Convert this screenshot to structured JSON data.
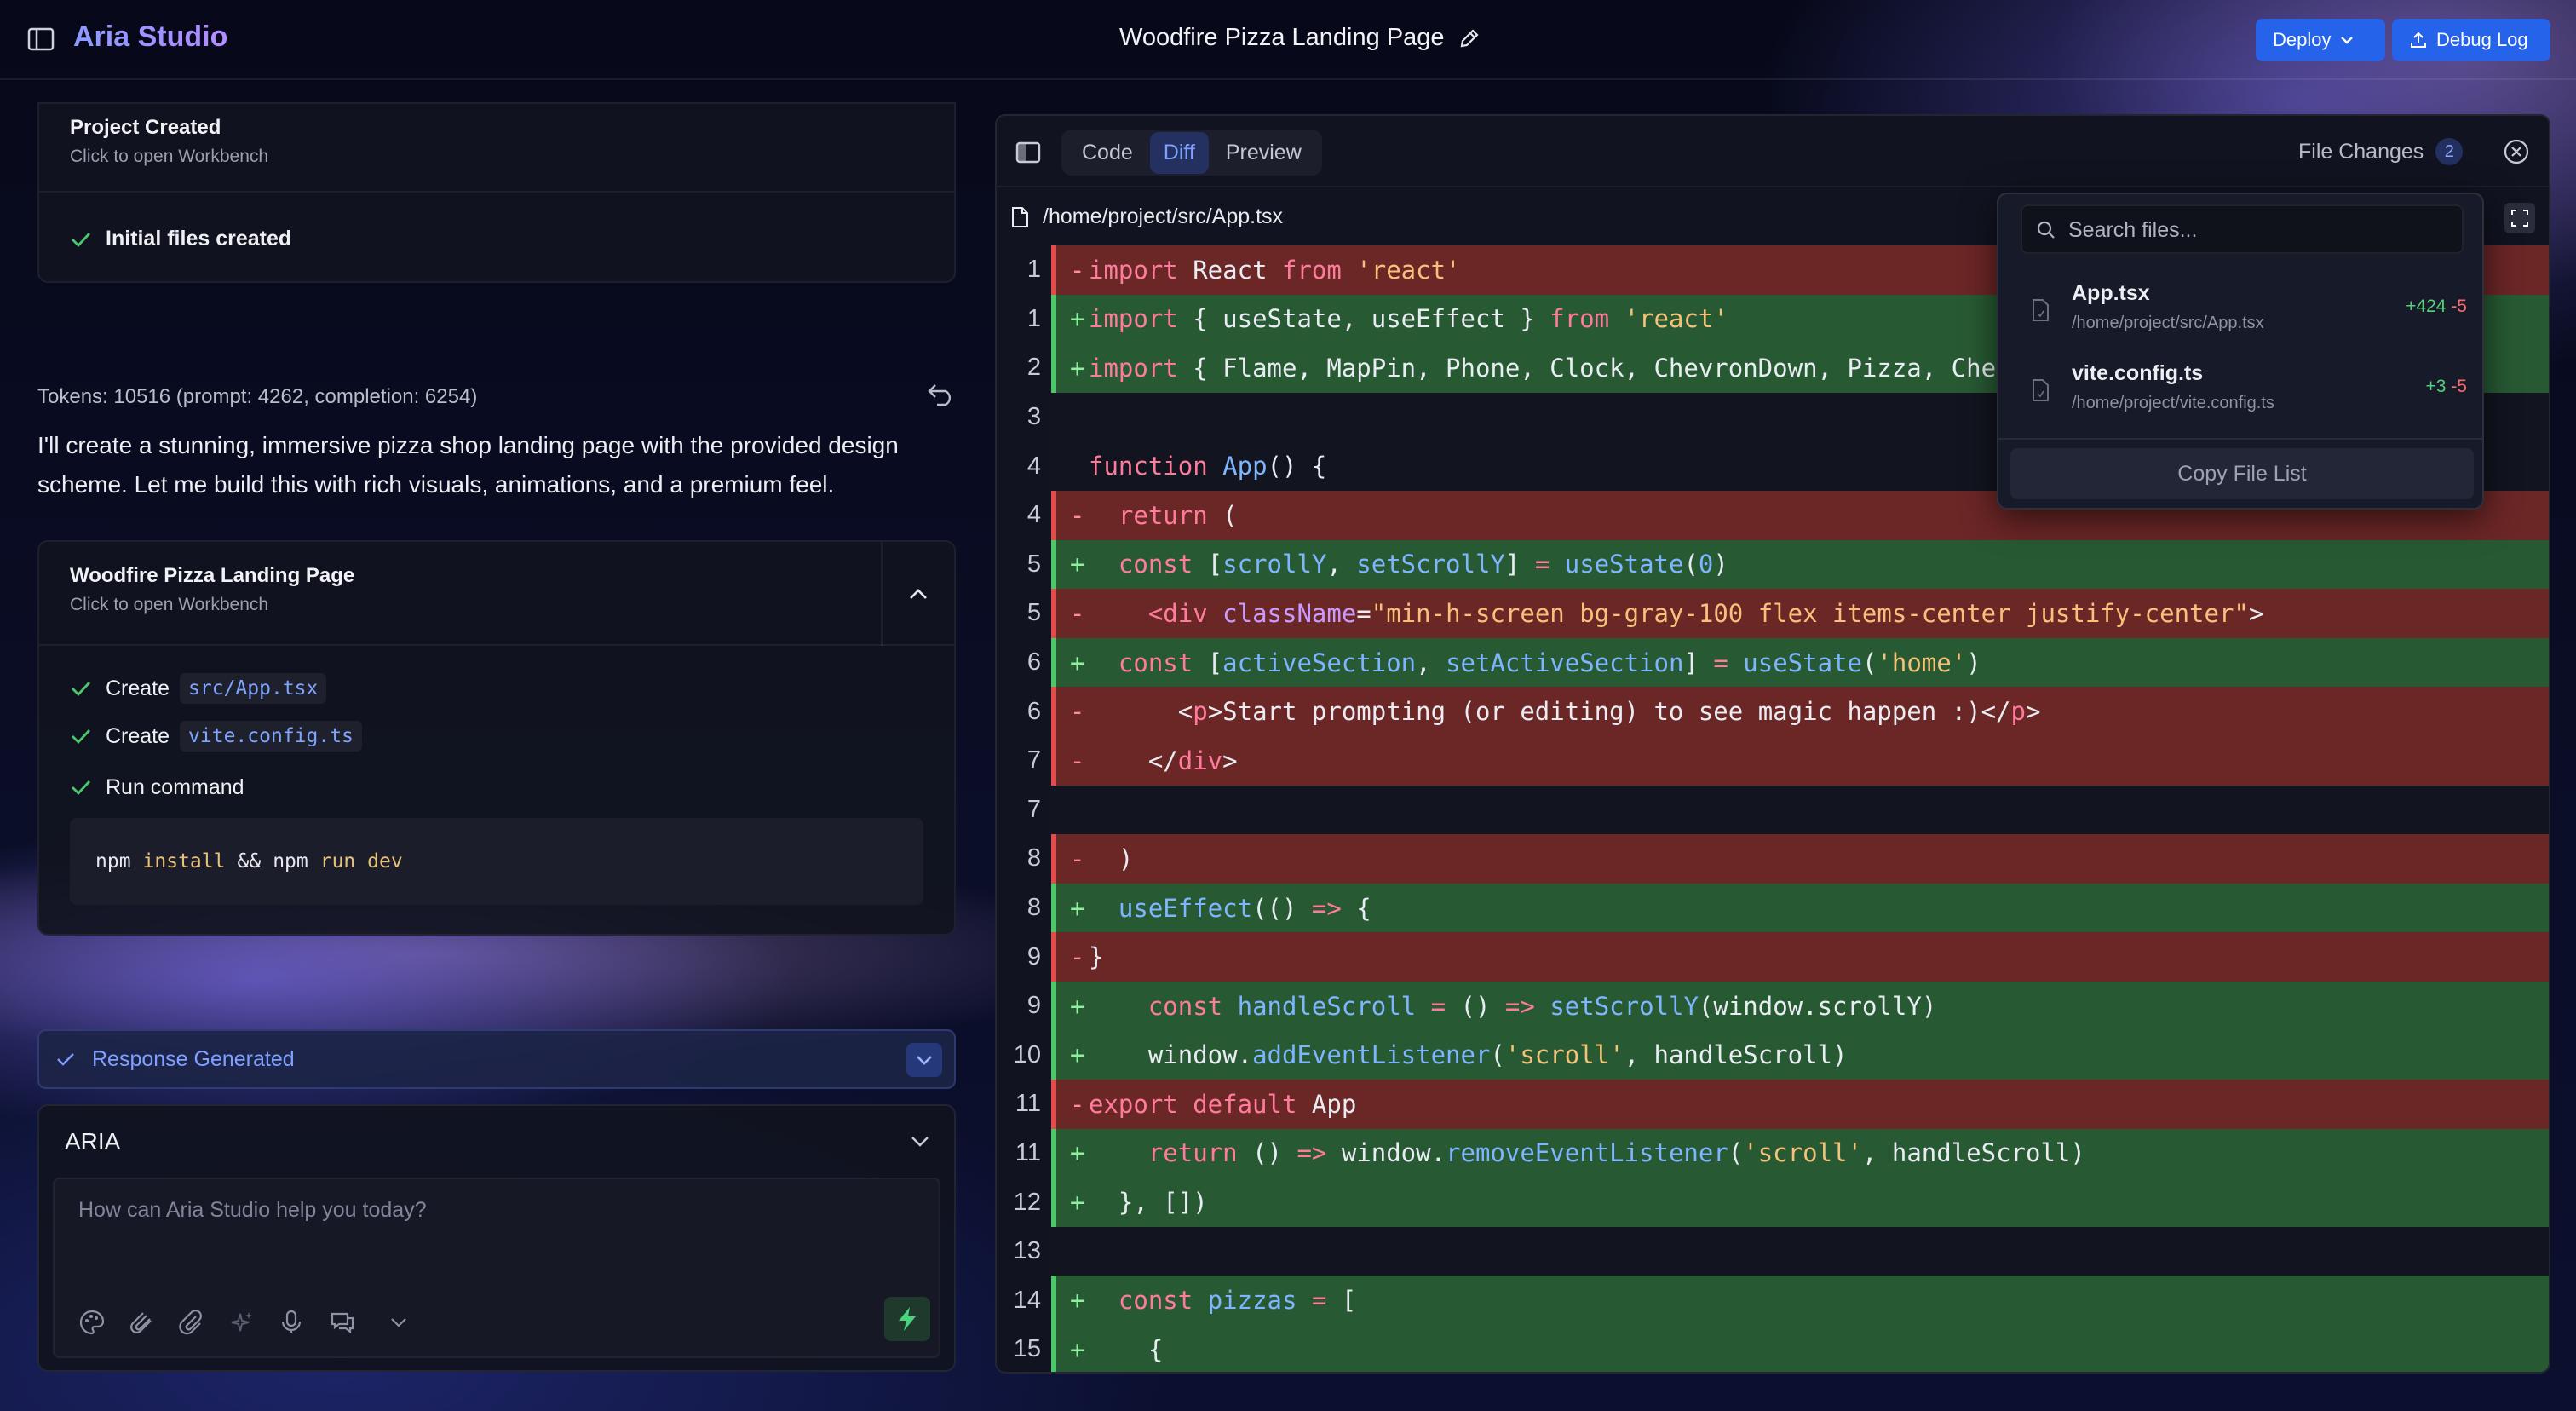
{
  "app": {
    "brand": "Aria Studio",
    "project_title": "Woodfire Pizza Landing Page",
    "deploy_label": "Deploy",
    "debug_label": "Debug Log"
  },
  "chat": {
    "card1": {
      "title": "Project Created",
      "subtitle": "Click to open Workbench",
      "item": "Initial files created"
    },
    "tokens": "Tokens: 10516 (prompt: 4262, completion: 6254)",
    "message": "I'll create a stunning, immersive pizza shop landing page with the provided design scheme. Let me build this with rich visuals, animations, and a premium feel.",
    "card2": {
      "title": "Woodfire Pizza Landing Page",
      "subtitle": "Click to open Workbench",
      "items": [
        {
          "action": "Create",
          "file": "src/App.tsx"
        },
        {
          "action": "Create",
          "file": "vite.config.ts"
        }
      ],
      "run_label": "Run command",
      "command": {
        "a": "npm",
        "b": "install",
        "c": "&&",
        "d": "npm",
        "e": "run dev"
      }
    },
    "response_label": "Response Generated",
    "model": "ARIA",
    "input_placeholder": "How can Aria Studio help you today?"
  },
  "workbench": {
    "tabs": [
      "Code",
      "Diff",
      "Preview"
    ],
    "active_tab": "Diff",
    "file_changes_label": "File Changes",
    "file_changes_count": "2",
    "file_path": "/home/project/src/App.tsx"
  },
  "file_popup": {
    "search_placeholder": "Search files...",
    "files": [
      {
        "name": "App.tsx",
        "path": "/home/project/src/App.tsx",
        "added": "+424",
        "removed": "-5"
      },
      {
        "name": "vite.config.ts",
        "path": "/home/project/vite.config.ts",
        "added": "+3",
        "removed": "-5"
      }
    ],
    "copy_label": "Copy File List"
  },
  "diff_lines": [
    {
      "n": "1",
      "t": "del",
      "m": "-",
      "html": "<span class='kw'>import</span> React <span class='kw'>from</span> <span class='str'>'react'</span>"
    },
    {
      "n": "1",
      "t": "add",
      "m": "+",
      "html": "<span class='kw'>import</span> { useState, useEffect } <span class='kw'>from</span> <span class='str'>'react'</span>"
    },
    {
      "n": "2",
      "t": "add",
      "m": "+",
      "html": "<span class='kw'>import</span> { Flame, MapPin, Phone, Clock, ChevronDown, Pizza, ChefHat, Star, Instagra"
    },
    {
      "n": "3",
      "t": "ctx",
      "m": "",
      "html": ""
    },
    {
      "n": "4",
      "t": "ctx",
      "m": "",
      "html": "<span class='kw'>function</span> <span class='fn'>App</span>() {"
    },
    {
      "n": "4",
      "t": "del",
      "m": "-",
      "html": "  <span class='kw'>return</span> ("
    },
    {
      "n": "5",
      "t": "add",
      "m": "+",
      "html": "  <span class='kw'>const</span> [<span class='fn'>scrollY</span>, <span class='fn'>setScrollY</span>] <span class='kw'>=</span> <span class='fn'>useState</span>(<span class='fn'>0</span>)"
    },
    {
      "n": "5",
      "t": "del",
      "m": "-",
      "html": "    <span class='tag'>&lt;div</span> <span class='attr'>className</span>=<span class='str'>\"min-h-screen bg-gray-100 flex items-center justify-center\"</span>&gt;"
    },
    {
      "n": "6",
      "t": "add",
      "m": "+",
      "html": "  <span class='kw'>const</span> [<span class='fn'>activeSection</span>, <span class='fn'>setActiveSection</span>] <span class='kw'>=</span> <span class='fn'>useState</span>(<span class='str'>'home'</span>)"
    },
    {
      "n": "6",
      "t": "del",
      "m": "-",
      "html": "      &lt;<span class='tag'>p</span>&gt;Start prompting (or editing) to see magic happen :)&lt;/<span class='tag'>p</span>&gt;"
    },
    {
      "n": "7",
      "t": "del",
      "m": "-",
      "html": "    &lt;/<span class='tag'>div</span>&gt;"
    },
    {
      "n": "7",
      "t": "ctx",
      "m": "",
      "html": ""
    },
    {
      "n": "8",
      "t": "del",
      "m": "-",
      "html": "  )"
    },
    {
      "n": "8",
      "t": "add",
      "m": "+",
      "html": "  <span class='fn'>useEffect</span>(() <span class='kw'>=&gt;</span> {"
    },
    {
      "n": "9",
      "t": "del",
      "m": "-",
      "html": "}"
    },
    {
      "n": "9",
      "t": "add",
      "m": "+",
      "html": "    <span class='kw'>const</span> <span class='fn'>handleScroll</span> <span class='kw'>=</span> () <span class='kw'>=&gt;</span> <span class='fn'>setScrollY</span>(window.scrollY)"
    },
    {
      "n": "10",
      "t": "add",
      "m": "+",
      "html": "    window.<span class='fn'>addEventListener</span>(<span class='str'>'scroll'</span>, handleScroll)"
    },
    {
      "n": "11",
      "t": "del",
      "m": "-",
      "html": "<span class='kw'>export default</span> App"
    },
    {
      "n": "11",
      "t": "add",
      "m": "+",
      "html": "    <span class='kw'>return</span> () <span class='kw'>=&gt;</span> window.<span class='fn'>removeEventListener</span>(<span class='str'>'scroll'</span>, handleScroll)"
    },
    {
      "n": "12",
      "t": "add",
      "m": "+",
      "html": "  }, [])"
    },
    {
      "n": "13",
      "t": "ctx",
      "m": "",
      "html": ""
    },
    {
      "n": "14",
      "t": "add",
      "m": "+",
      "html": "  <span class='kw'>const</span> <span class='fn'>pizzas</span> <span class='kw'>=</span> ["
    },
    {
      "n": "15",
      "t": "add",
      "m": "+",
      "html": "    {"
    }
  ],
  "colors": {
    "accent": "#2563eb",
    "added": "#275a33",
    "removed": "#6b2626"
  }
}
